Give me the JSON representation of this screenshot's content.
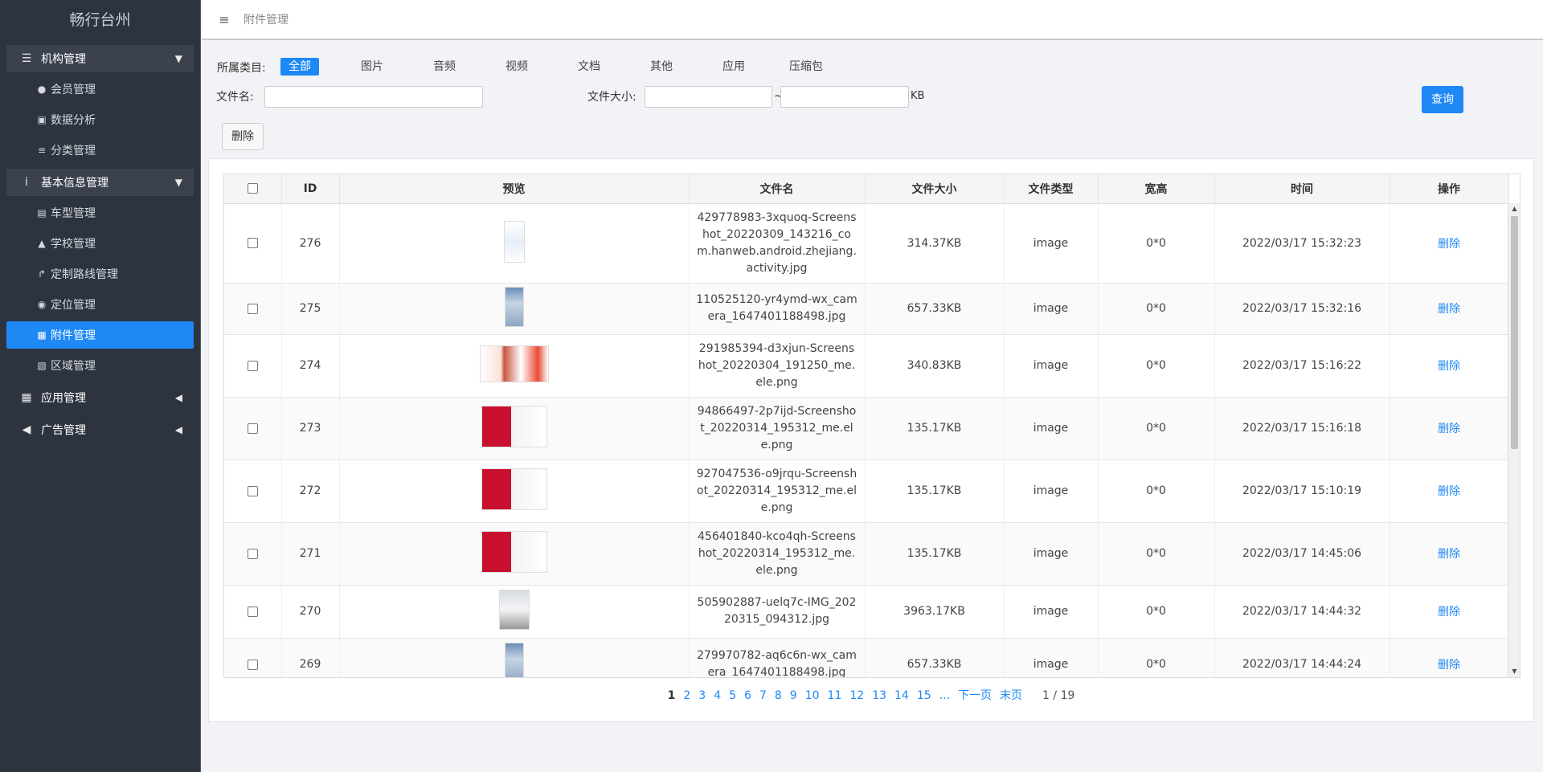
{
  "app": {
    "brand": "畅行台州"
  },
  "sidebar": {
    "groups": [
      {
        "label": "机构管理",
        "icon": "list-icon",
        "expanded": true,
        "items": [
          {
            "label": "会员管理",
            "icon": "member-icon"
          },
          {
            "label": "数据分析",
            "icon": "chart-icon"
          },
          {
            "label": "分类管理",
            "icon": "list-icon"
          }
        ]
      },
      {
        "label": "基本信息管理",
        "icon": "info-icon",
        "expanded": true,
        "items": [
          {
            "label": "车型管理",
            "icon": "truck-icon"
          },
          {
            "label": "学校管理",
            "icon": "graduation-cap-icon"
          },
          {
            "label": "定制路线管理",
            "icon": "route-icon"
          },
          {
            "label": "定位管理",
            "icon": "map-pin-icon"
          },
          {
            "label": "附件管理",
            "icon": "attachment-icon",
            "active": true
          },
          {
            "label": "区域管理",
            "icon": "map-icon"
          }
        ]
      },
      {
        "label": "应用管理",
        "icon": "grid-icon",
        "expanded": false
      },
      {
        "label": "广告管理",
        "icon": "bullhorn-icon",
        "expanded": false
      }
    ]
  },
  "header": {
    "breadcrumb": "附件管理"
  },
  "filters": {
    "category_label": "所属类目:",
    "categories": [
      "全部",
      "图片",
      "音频",
      "视频",
      "文档",
      "其他",
      "应用",
      "压缩包"
    ],
    "active_category": "全部",
    "filename_label": "文件名:",
    "filename_value": "",
    "size_label": "文件大小:",
    "size_min": "",
    "size_sep": "~",
    "size_max": "",
    "size_unit": "KB",
    "query_label": "查询",
    "delete_label": "删除"
  },
  "table": {
    "columns": [
      "ID",
      "预览",
      "文件名",
      "文件大小",
      "文件类型",
      "宽高",
      "时间",
      "操作"
    ],
    "rows": [
      {
        "id": "276",
        "thumb": "phone",
        "filename": "429778983-3xquoq-Screenshot_20220309_143216_com.hanweb.android.zhejiang.activity.jpg",
        "size": "314.37KB",
        "type": "image",
        "wh": "0*0",
        "time": "2022/03/17 15:32:23",
        "action": "删除"
      },
      {
        "id": "275",
        "thumb": "tall",
        "filename": "110525120-yr4ymd-wx_camera_1647401188498.jpg",
        "size": "657.33KB",
        "type": "image",
        "wh": "0*0",
        "time": "2022/03/17 15:32:16",
        "action": "删除"
      },
      {
        "id": "274",
        "thumb": "wide",
        "filename": "291985394-d3xjun-Screenshot_20220304_191250_me.ele.png",
        "size": "340.83KB",
        "type": "image",
        "wh": "0*0",
        "time": "2022/03/17 15:16:22",
        "action": "删除"
      },
      {
        "id": "273",
        "thumb": "red",
        "filename": "94866497-2p7ijd-Screenshot_20220314_195312_me.ele.png",
        "size": "135.17KB",
        "type": "image",
        "wh": "0*0",
        "time": "2022/03/17 15:16:18",
        "action": "删除"
      },
      {
        "id": "272",
        "thumb": "red",
        "filename": "927047536-o9jrqu-Screenshot_20220314_195312_me.ele.png",
        "size": "135.17KB",
        "type": "image",
        "wh": "0*0",
        "time": "2022/03/17 15:10:19",
        "action": "删除"
      },
      {
        "id": "271",
        "thumb": "red",
        "filename": "456401840-kco4qh-Screenshot_20220314_195312_me.ele.png",
        "size": "135.17KB",
        "type": "image",
        "wh": "0*0",
        "time": "2022/03/17 14:45:06",
        "action": "删除"
      },
      {
        "id": "270",
        "thumb": "doc",
        "filename": "505902887-uelq7c-IMG_20220315_094312.jpg",
        "size": "3963.17KB",
        "type": "image",
        "wh": "0*0",
        "time": "2022/03/17 14:44:32",
        "action": "删除"
      },
      {
        "id": "269",
        "thumb": "tall",
        "filename": "279970782-aq6c6n-wx_camera_1647401188498.jpg",
        "size": "657.33KB",
        "type": "image",
        "wh": "0*0",
        "time": "2022/03/17 14:44:24",
        "action": "删除"
      }
    ]
  },
  "pagination": {
    "current": "1",
    "pages": [
      "1",
      "2",
      "3",
      "4",
      "5",
      "6",
      "7",
      "8",
      "9",
      "10",
      "11",
      "12",
      "13",
      "14",
      "15"
    ],
    "ellipsis": "...",
    "next": "下一页",
    "last": "末页",
    "total": "1 / 19"
  },
  "colors": {
    "accent": "#1e88f5",
    "sidebar_bg": "#2d3440"
  }
}
